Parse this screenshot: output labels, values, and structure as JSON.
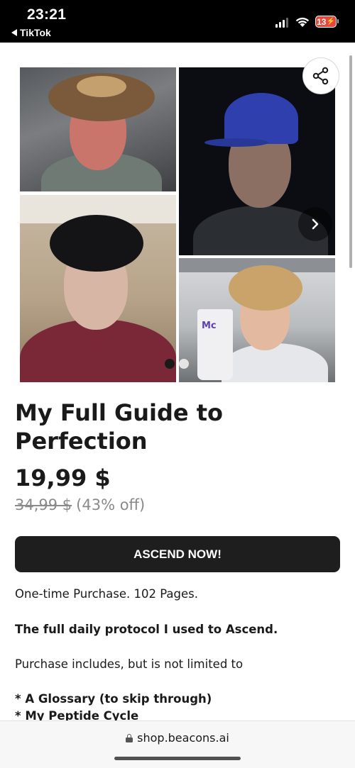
{
  "status_bar": {
    "time": "23:21",
    "back_app": "TikTok",
    "battery": "13"
  },
  "gallery": {
    "photo_count": 4,
    "active_dot": 1,
    "dot_count": 2,
    "cup_text": "Mc"
  },
  "product": {
    "title": "My Full Guide to Perfection",
    "price": "19,99 $",
    "original_price": "34,99 $",
    "discount": "(43% off)",
    "cta_label": "ASCEND NOW!"
  },
  "description": {
    "line1": "One-time Purchase. 102 Pages.",
    "line2": "The full daily protocol I used to Ascend.",
    "line3": "Purchase includes, but is not limited to",
    "bullet1": "* A Glossary (to skip through)",
    "bullet2": "* My Peptide Cycle"
  },
  "browser": {
    "url": "shop.beacons.ai"
  },
  "colors": {
    "cta_bg": "#1e1e1e",
    "battery_low": "#e8453c"
  },
  "icons": {
    "share": "share-icon",
    "next": "chevron-right-icon",
    "lock": "lock-icon"
  }
}
